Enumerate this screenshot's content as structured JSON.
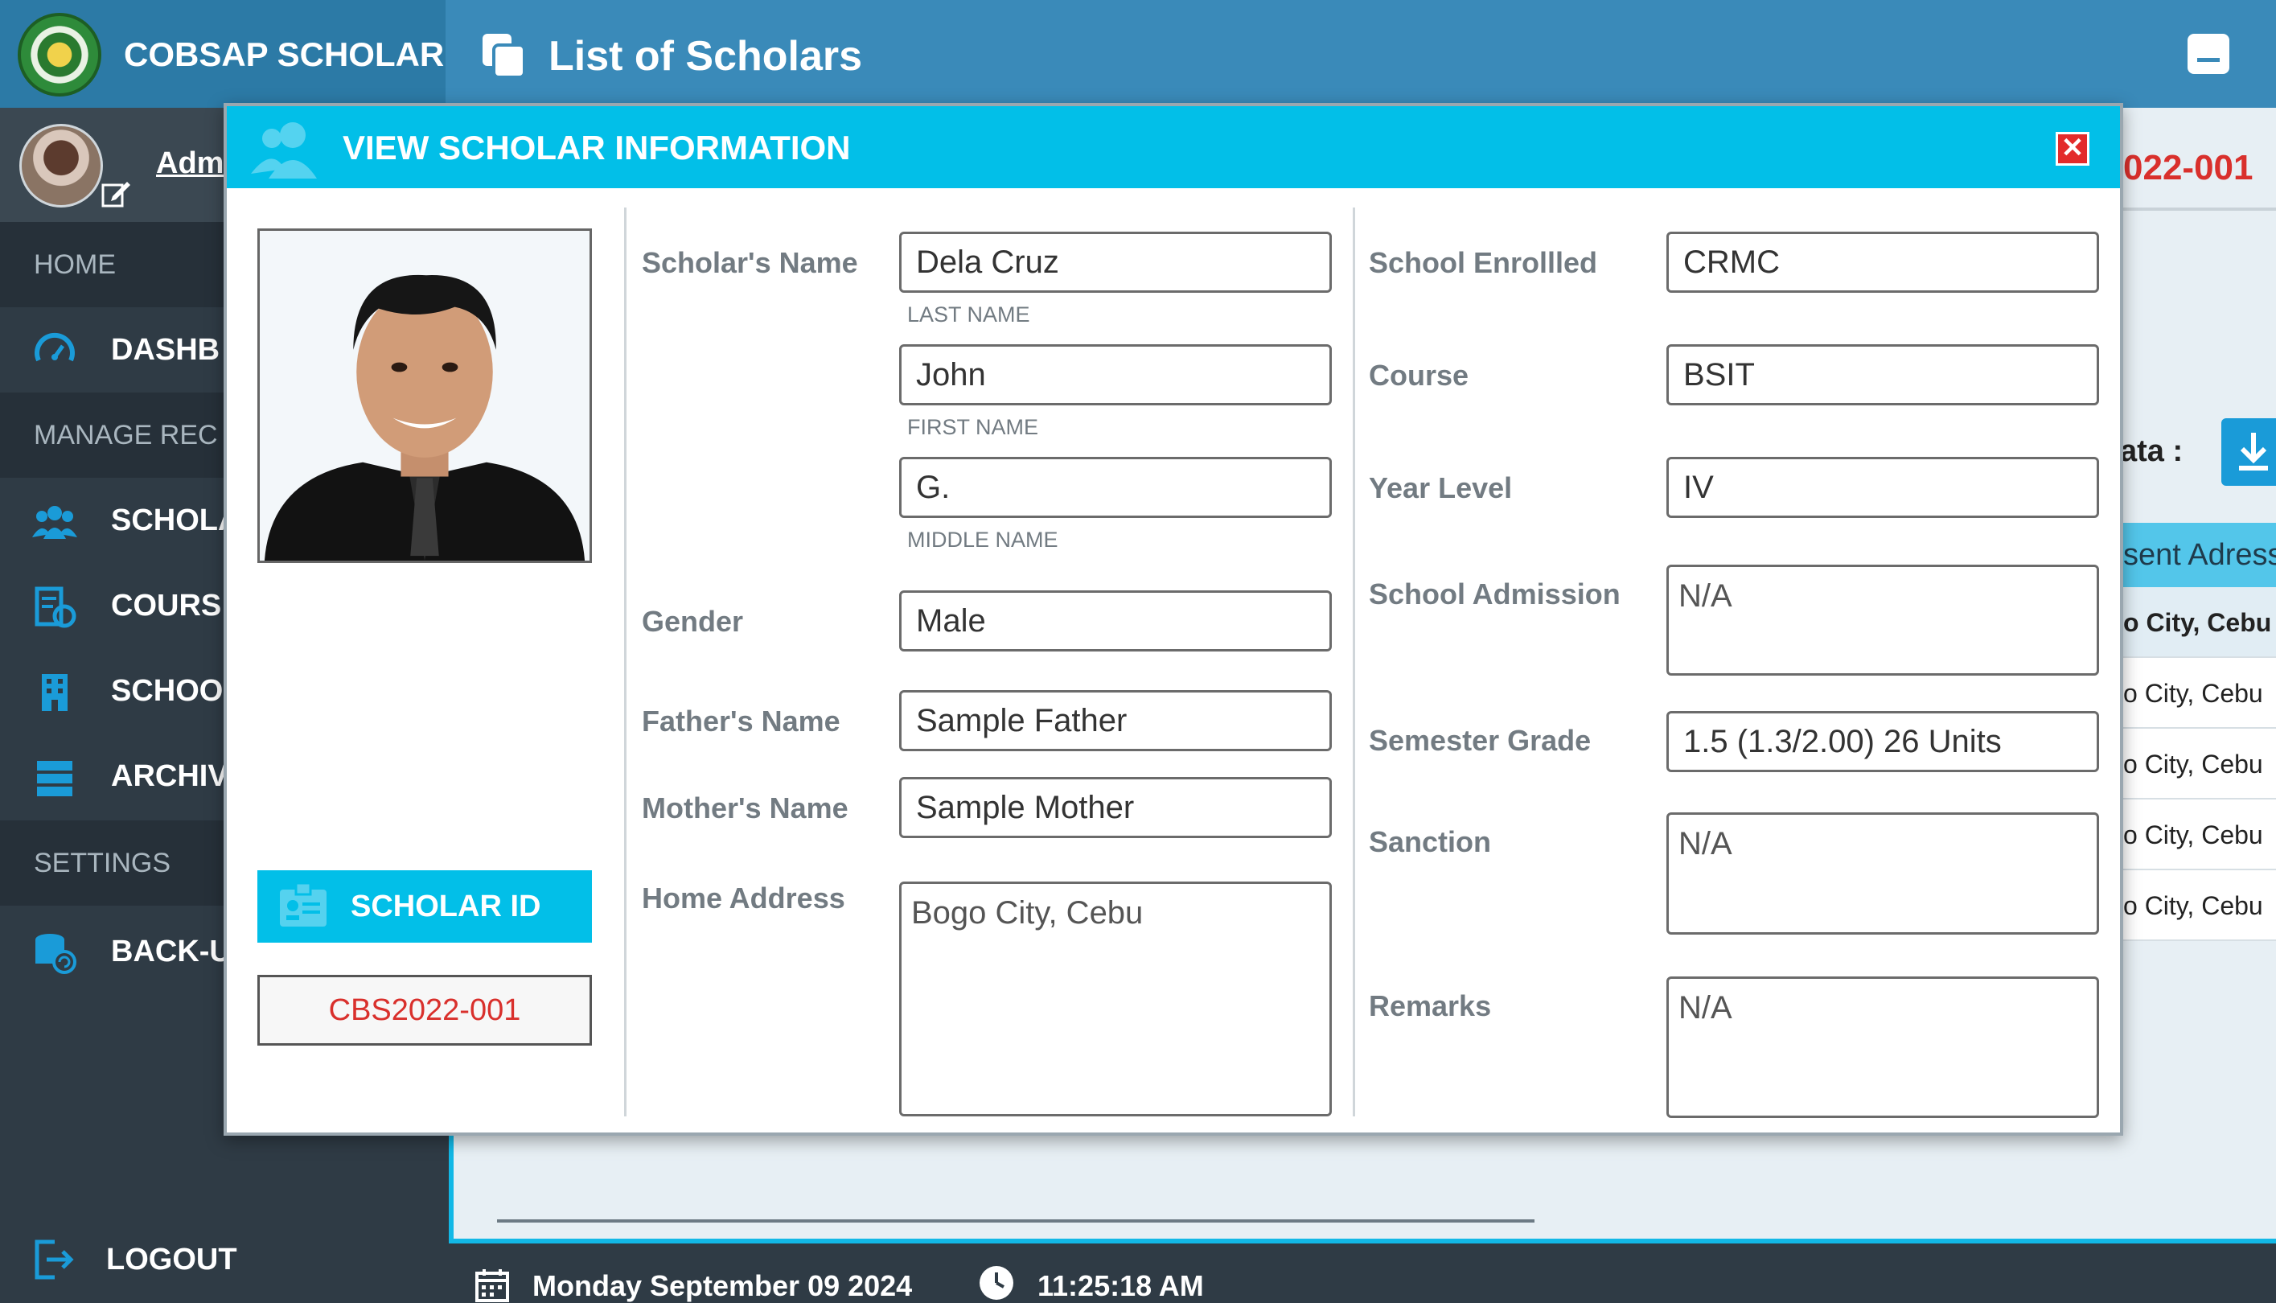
{
  "app": {
    "brand": "COBSAP SCHOLAR",
    "user_name": "Admi"
  },
  "sidebar": {
    "sections": {
      "home": "HOME",
      "manage": "MANAGE REC",
      "settings": "SETTINGS"
    },
    "items": [
      {
        "label": "DASHB",
        "icon": "dashboard-icon"
      },
      {
        "label": "SCHOLA",
        "icon": "scholars-icon"
      },
      {
        "label": "COURS",
        "icon": "courses-icon"
      },
      {
        "label": "SCHOO",
        "icon": "school-icon"
      },
      {
        "label": "ARCHIV",
        "icon": "archive-icon"
      },
      {
        "label": "BACK-U",
        "icon": "backup-icon"
      }
    ],
    "logout": "LOGOUT"
  },
  "topbar": {
    "title": "List of Scholars"
  },
  "background": {
    "id_fragment": "022-001",
    "data_label": "ata :",
    "header": "sent Adress",
    "rows": [
      "o City, Cebu",
      "o City, Cebu",
      "o City, Cebu",
      "o City, Cebu",
      "o City, Cebu"
    ]
  },
  "modal": {
    "title": "VIEW SCHOLAR INFORMATION",
    "close": "✕",
    "scholar_id_button": "SCHOLAR ID",
    "scholar_id": "CBS2022-001",
    "labels": {
      "name": "Scholar's Name",
      "last": "LAST NAME",
      "first": "FIRST NAME",
      "middle": "MIDDLE NAME",
      "gender": "Gender",
      "father": "Father's Name",
      "mother": "Mother's Name",
      "address": "Home Address",
      "school": "School Enrollled",
      "course": "Course",
      "year": "Year Level",
      "admission": "School Admission",
      "grade": "Semester Grade",
      "sanction": "Sanction",
      "remarks": "Remarks"
    },
    "values": {
      "last_name": "Dela Cruz",
      "first_name": "John",
      "middle_name": "G.",
      "gender": "Male",
      "father": "Sample Father",
      "mother": "Sample Mother",
      "address": "Bogo City, Cebu",
      "school": "CRMC",
      "course": "BSIT",
      "year": "IV",
      "admission": "N/A",
      "grade": "1.5 (1.3/2.00) 26 Units",
      "sanction": "N/A",
      "remarks": "N/A"
    }
  },
  "status": {
    "date": "Monday September 09 2024",
    "time": "11:25:18 AM"
  }
}
